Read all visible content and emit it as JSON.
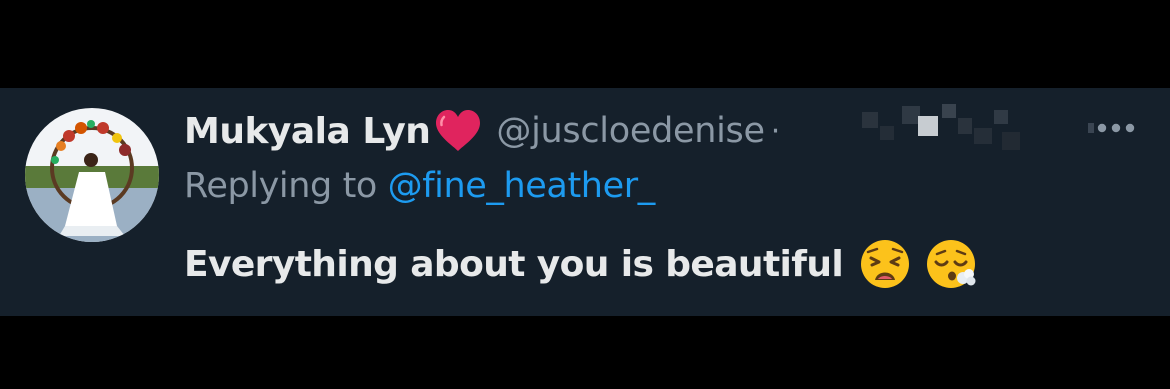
{
  "tweet": {
    "display_name": "Mukyala Lyn",
    "name_emoji": "red-heart-icon",
    "handle": "@juscloedenise",
    "separator": "·",
    "timestamp_hidden": true,
    "replying_label": "Replying to ",
    "replying_to": "@fine_heather_",
    "text": "Everything about you is beautiful",
    "emojis": [
      "weary-face-icon",
      "face-exhaling-icon"
    ],
    "more_icon": "more-options-icon",
    "avatar": "user-avatar"
  },
  "colors": {
    "page_background": "#000000",
    "tweet_background": "#15202b",
    "primary_text": "#e7e9ea",
    "secondary_text": "#8b98a5",
    "link": "#1d9bf0",
    "heart": "#e0245e"
  }
}
